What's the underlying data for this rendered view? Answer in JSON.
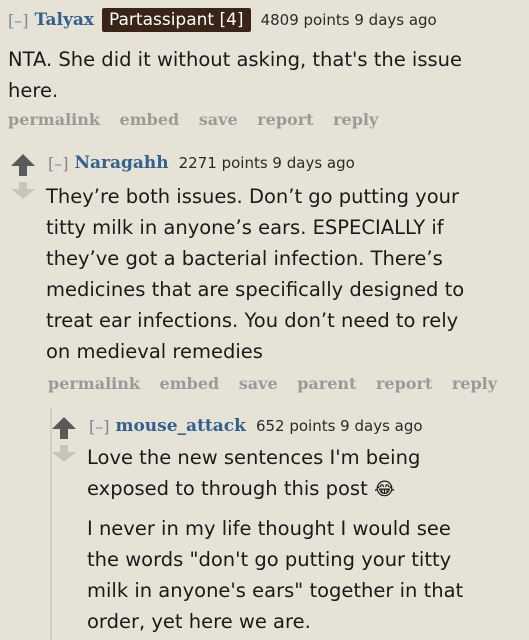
{
  "comments": [
    {
      "toggle": "[–]",
      "author": "Talyax",
      "flair": "Partassipant [4]",
      "meta": "4809 points 9 days ago",
      "lines": [
        "NTA. She did it without asking, that's the issue",
        "here."
      ],
      "actions": [
        "permalink",
        "embed",
        "save",
        "report",
        "reply"
      ]
    },
    {
      "toggle": "[–]",
      "author": "Naragahh",
      "meta": "2271 points 9 days ago",
      "lines": [
        "They’re both issues. Don’t go putting your",
        "titty milk in anyone’s ears. ESPECIALLY if",
        "they’ve got a bacterial infection. There’s",
        "medicines that are specifically designed to",
        "treat ear infections. You don’t need to rely",
        "on medieval remedies"
      ],
      "actions": [
        "permalink",
        "embed",
        "save",
        "parent",
        "report",
        "reply"
      ]
    },
    {
      "toggle": "[–]",
      "author": "mouse_attack",
      "meta": "652 points 9 days ago",
      "para1": [
        "Love the new sentences I'm being",
        "exposed to through this post"
      ],
      "emoji": "😂",
      "para2": [
        "I never in my life thought I would see",
        "the words \"don't go putting your titty",
        "milk in anyone's ears\" together in that",
        "order, yet here we are."
      ]
    }
  ]
}
